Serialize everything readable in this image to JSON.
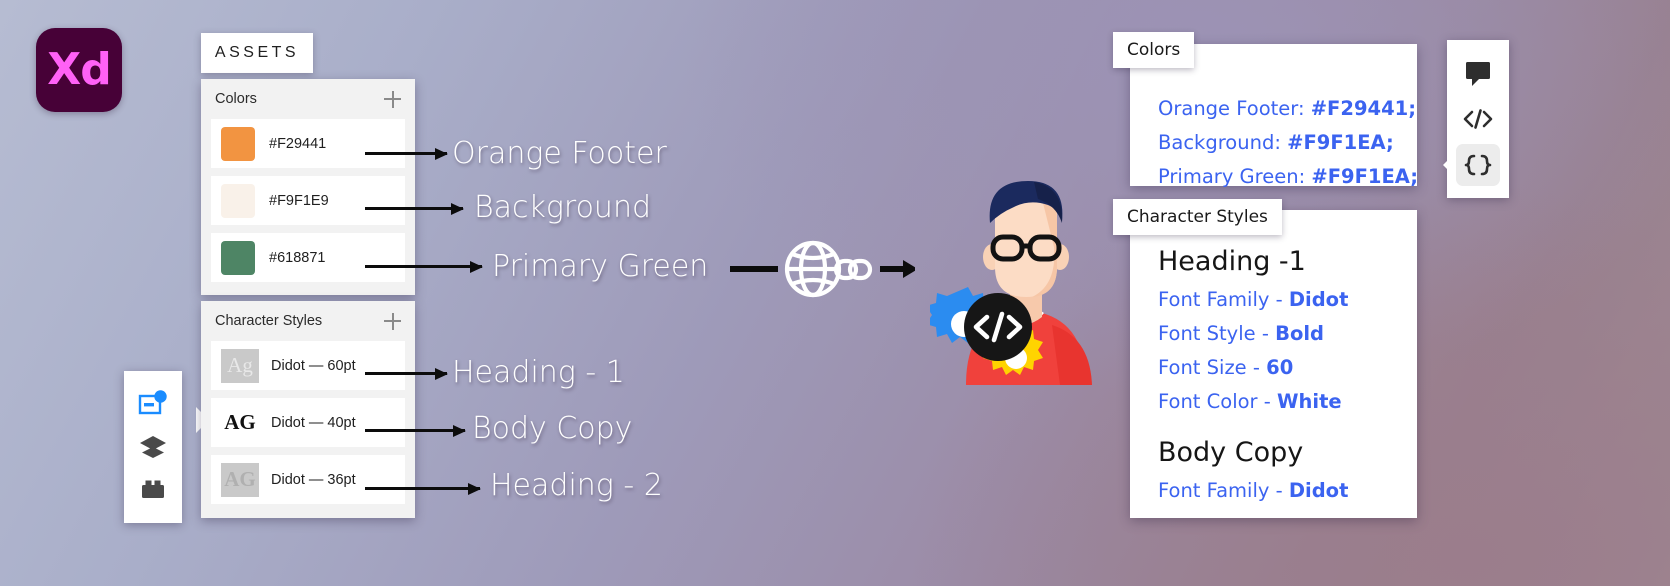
{
  "app": {
    "logo_text": "Xd",
    "logo_bg": "#470137",
    "logo_fg": "#ff61f6"
  },
  "left_toolbar": {
    "items": [
      {
        "name": "assets-icon",
        "label": "Assets"
      },
      {
        "name": "layers-icon",
        "label": "Layers"
      },
      {
        "name": "components-icon",
        "label": "Components"
      }
    ]
  },
  "assets_tab": {
    "label": "ASSETS"
  },
  "colors_panel": {
    "title": "Colors",
    "add_label": "+",
    "swatches": [
      {
        "hex": "#F29441",
        "color": "#F29441",
        "annotation": "Orange Footer"
      },
      {
        "hex": "#F9F1E9",
        "color": "#F9F1E9",
        "annotation": "Background"
      },
      {
        "hex": "#618871",
        "color": "#4E8565",
        "annotation": "Primary Green"
      }
    ]
  },
  "character_styles_panel": {
    "title": "Character Styles",
    "add_label": "+",
    "styles": [
      {
        "thumb": "Ag",
        "label": "Didot — 60pt",
        "annotation": "Heading - 1"
      },
      {
        "thumb": "AG",
        "label": "Didot — 40pt",
        "annotation": "Body Copy"
      },
      {
        "thumb": "AG",
        "label": "Didot — 36pt",
        "annotation": "Heading - 2"
      }
    ]
  },
  "center": {
    "globe_icon": "globe-icon",
    "link_icon": "link-icon",
    "avatar": "developer-avatar"
  },
  "right_colors": {
    "tab_label": "Colors",
    "lines": [
      {
        "key": "Orange Footer: ",
        "value": "#F29441;"
      },
      {
        "key": "Background: ",
        "value": "#F9F1EA;"
      },
      {
        "key": "Primary Green: ",
        "value": "#F9F1EA;"
      }
    ]
  },
  "right_character_styles": {
    "tab_label": "Character Styles",
    "groups": [
      {
        "title": "Heading -1",
        "props": [
          {
            "key": "Font Family  - ",
            "value": "Didot"
          },
          {
            "key": "Font Style - ",
            "value": "Bold"
          },
          {
            "key": "Font Size  -  ",
            "value": "60"
          },
          {
            "key": "Font Color - ",
            "value": "White"
          }
        ]
      },
      {
        "title": "Body Copy",
        "props": [
          {
            "key": "Font Family  - ",
            "value": "Didot"
          }
        ]
      }
    ]
  },
  "right_toolbar": {
    "items": [
      {
        "name": "comment-icon",
        "label": "Comment"
      },
      {
        "name": "code-icon",
        "label": "Code"
      },
      {
        "name": "braces-icon",
        "label": "Design Tokens"
      }
    ]
  }
}
